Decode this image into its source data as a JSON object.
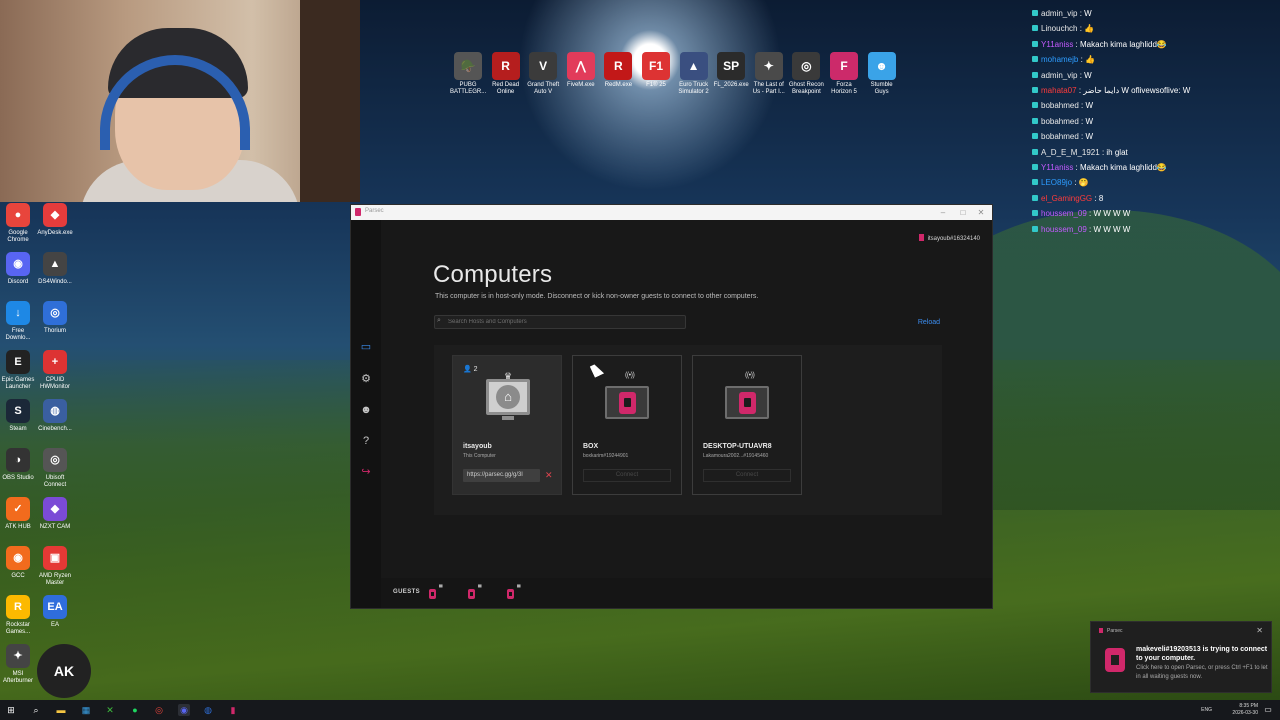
{
  "desktop_left_icons": [
    {
      "label": "Google Chrome",
      "color": "#e8453c",
      "glyph": "●"
    },
    {
      "label": "AnyDesk.exe",
      "color": "#e53c3c",
      "glyph": "◆"
    },
    {
      "label": "Discord",
      "color": "#5865f2",
      "glyph": "◉"
    },
    {
      "label": "DS4Windo...",
      "color": "#444",
      "glyph": "▲"
    },
    {
      "label": "Free Downlo...",
      "color": "#1e88e5",
      "glyph": "↓"
    },
    {
      "label": "Thorium",
      "color": "#2f6fd8",
      "glyph": "◎"
    },
    {
      "label": "Epic Games Launcher",
      "color": "#222",
      "glyph": "E"
    },
    {
      "label": "CPUID HWMonitor",
      "color": "#d33",
      "glyph": "+"
    },
    {
      "label": "Steam",
      "color": "#1b2838",
      "glyph": "S"
    },
    {
      "label": "Cinebench...",
      "color": "#3a5fa0",
      "glyph": "◍"
    },
    {
      "label": "OBS Studio",
      "color": "#333",
      "glyph": "◑"
    },
    {
      "label": "Ubisoft Connect",
      "color": "#555",
      "glyph": "◎"
    },
    {
      "label": "ATK HUB",
      "color": "#f26b1d",
      "glyph": "✓"
    },
    {
      "label": "NZXT CAM",
      "color": "#7b4bd6",
      "glyph": "◆"
    },
    {
      "label": "GCC",
      "color": "#f26b1d",
      "glyph": "◉"
    },
    {
      "label": "AMD Ryzen Master",
      "color": "#e53935",
      "glyph": "▣"
    },
    {
      "label": "Rockstar Games...",
      "color": "#fcb900",
      "glyph": "R"
    },
    {
      "label": "EA",
      "color": "#2f6ddc",
      "glyph": "EA"
    },
    {
      "label": "MSI Afterburner",
      "color": "#444",
      "glyph": "✦"
    },
    {
      "label": "",
      "color": "#222",
      "glyph": "AK"
    }
  ],
  "desktop_top_icons": [
    {
      "label": "PUBG BATTLEGR...",
      "color": "#555",
      "glyph": "🪖"
    },
    {
      "label": "Red Dead Online",
      "color": "#b51e1e",
      "glyph": "R"
    },
    {
      "label": "Grand Theft Auto V",
      "color": "#3b3b3b",
      "glyph": "V"
    },
    {
      "label": "FiveM.exe",
      "color": "#e23b5a",
      "glyph": "⋀"
    },
    {
      "label": "RedM.exe",
      "color": "#c21818",
      "glyph": "R"
    },
    {
      "label": "F1® 25",
      "color": "#d33",
      "glyph": "F1"
    },
    {
      "label": "Euro Truck Simulator 2",
      "color": "#3a4f80",
      "glyph": "▲"
    },
    {
      "label": "FL_2026.exe",
      "color": "#2b2b2b",
      "glyph": "SP"
    },
    {
      "label": "The Last of Us - Part I...",
      "color": "#4a4a4a",
      "glyph": "✦"
    },
    {
      "label": "Ghost Recon Breakpoint",
      "color": "#3a3a3a",
      "glyph": "◎"
    },
    {
      "label": "Forza Horizon 5",
      "color": "#cc2a6a",
      "glyph": "F"
    },
    {
      "label": "Stumble Guys",
      "color": "#3aa3e8",
      "glyph": "☻"
    }
  ],
  "chat": [
    {
      "user": "admin_vip",
      "sep": " : ",
      "msg": "W",
      "color": "#e9e9e9"
    },
    {
      "user": "Linouchch",
      "sep": " : ",
      "msg": "👍",
      "color": "#e9e9e9"
    },
    {
      "user": "Y11aniss",
      "sep": " : ",
      "msg": "Makach kima laghlidd😂",
      "color": "#c45bff"
    },
    {
      "user": "mohamejb",
      "sep": " : ",
      "msg": "👍",
      "color": "#2d9cff"
    },
    {
      "user": "admin_vip",
      "sep": " : ",
      "msg": "W",
      "color": "#e9e9e9"
    },
    {
      "user": "mahata07",
      "sep": " : ",
      "msg": "دايما حاضر W  oflivewsoflive: W",
      "color": "#ff3b3b"
    },
    {
      "user": "bobahmed",
      "sep": " : ",
      "msg": "W",
      "color": "#e9e9e9"
    },
    {
      "user": "bobahmed",
      "sep": " : ",
      "msg": "W",
      "color": "#e9e9e9"
    },
    {
      "user": "bobahmed",
      "sep": " : ",
      "msg": "W",
      "color": "#e9e9e9"
    },
    {
      "user": "A_D_E_M_1921",
      "sep": " : ",
      "msg": "ih glat",
      "color": "#e9e9e9"
    },
    {
      "user": "Y11aniss",
      "sep": " : ",
      "msg": "Makach kima laghlidd😂",
      "color": "#c45bff"
    },
    {
      "user": "LEO89jo",
      "sep": " : ",
      "msg": "🤭",
      "color": "#2d9cff"
    },
    {
      "user": "el_GamingGG",
      "sep": " : ",
      "msg": "8",
      "color": "#ff3b3b"
    },
    {
      "user": "houssem_09",
      "sep": " : ",
      "msg": "W  W  W  W",
      "color": "#c45bff"
    },
    {
      "user": "houssem_09",
      "sep": " : ",
      "msg": "W  W  W  W",
      "color": "#c45bff"
    }
  ],
  "parsec": {
    "window_title": "Parsec",
    "user_id": "itsayoub#16324140",
    "page_title": "Computers",
    "subtitle": "This computer is in host-only mode. Disconnect or kick non-owner guests to connect to other computers.",
    "search_placeholder": "Search Hosts and Computers",
    "reload_label": "Reload",
    "this_computer": {
      "guest_count": "2",
      "name": "itsayoub",
      "sub": "This Computer",
      "share_link": "https://parsec.gg/g/3l"
    },
    "hosts": [
      {
        "name": "BOX",
        "sub": "boxkarim#19244901",
        "connect_label": "Connect"
      },
      {
        "name": "DESKTOP-UTUAVR8",
        "sub": "Lakamoura2002...#19145460",
        "connect_label": "Connect"
      }
    ],
    "guests_label": "GUESTS",
    "guest_icon_count": 3
  },
  "notification": {
    "app": "Parsec",
    "title": "makeveli#19203513 is trying to connect to your computer.",
    "body": "Click here to open Parsec, or press Ctrl +F1 to let in all waiting guests now."
  },
  "taskbar": {
    "lang": "ENG",
    "time": "8:35 PM",
    "date": "2026-03-30"
  }
}
